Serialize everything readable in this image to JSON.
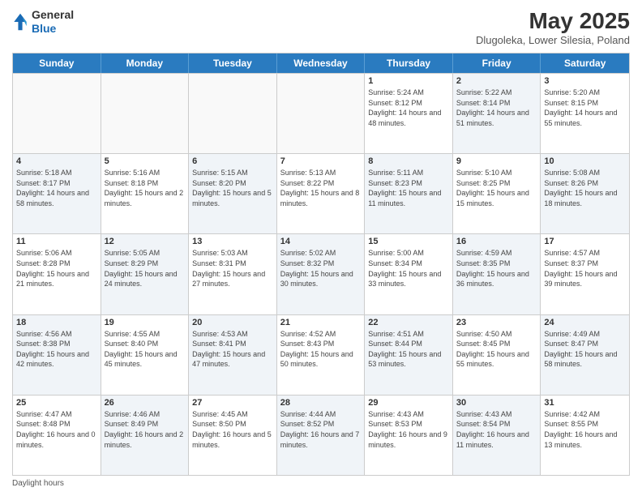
{
  "header": {
    "logo_line1": "General",
    "logo_line2": "Blue",
    "title": "May 2025",
    "subtitle": "Dlugoleka, Lower Silesia, Poland"
  },
  "days_of_week": [
    "Sunday",
    "Monday",
    "Tuesday",
    "Wednesday",
    "Thursday",
    "Friday",
    "Saturday"
  ],
  "weeks": [
    [
      {
        "day": "",
        "info": "",
        "shaded": false,
        "empty": true
      },
      {
        "day": "",
        "info": "",
        "shaded": false,
        "empty": true
      },
      {
        "day": "",
        "info": "",
        "shaded": false,
        "empty": true
      },
      {
        "day": "",
        "info": "",
        "shaded": false,
        "empty": true
      },
      {
        "day": "1",
        "info": "Sunrise: 5:24 AM\nSunset: 8:12 PM\nDaylight: 14 hours\nand 48 minutes.",
        "shaded": false,
        "empty": false
      },
      {
        "day": "2",
        "info": "Sunrise: 5:22 AM\nSunset: 8:14 PM\nDaylight: 14 hours\nand 51 minutes.",
        "shaded": true,
        "empty": false
      },
      {
        "day": "3",
        "info": "Sunrise: 5:20 AM\nSunset: 8:15 PM\nDaylight: 14 hours\nand 55 minutes.",
        "shaded": false,
        "empty": false
      }
    ],
    [
      {
        "day": "4",
        "info": "Sunrise: 5:18 AM\nSunset: 8:17 PM\nDaylight: 14 hours\nand 58 minutes.",
        "shaded": true,
        "empty": false
      },
      {
        "day": "5",
        "info": "Sunrise: 5:16 AM\nSunset: 8:18 PM\nDaylight: 15 hours\nand 2 minutes.",
        "shaded": false,
        "empty": false
      },
      {
        "day": "6",
        "info": "Sunrise: 5:15 AM\nSunset: 8:20 PM\nDaylight: 15 hours\nand 5 minutes.",
        "shaded": true,
        "empty": false
      },
      {
        "day": "7",
        "info": "Sunrise: 5:13 AM\nSunset: 8:22 PM\nDaylight: 15 hours\nand 8 minutes.",
        "shaded": false,
        "empty": false
      },
      {
        "day": "8",
        "info": "Sunrise: 5:11 AM\nSunset: 8:23 PM\nDaylight: 15 hours\nand 11 minutes.",
        "shaded": true,
        "empty": false
      },
      {
        "day": "9",
        "info": "Sunrise: 5:10 AM\nSunset: 8:25 PM\nDaylight: 15 hours\nand 15 minutes.",
        "shaded": false,
        "empty": false
      },
      {
        "day": "10",
        "info": "Sunrise: 5:08 AM\nSunset: 8:26 PM\nDaylight: 15 hours\nand 18 minutes.",
        "shaded": true,
        "empty": false
      }
    ],
    [
      {
        "day": "11",
        "info": "Sunrise: 5:06 AM\nSunset: 8:28 PM\nDaylight: 15 hours\nand 21 minutes.",
        "shaded": false,
        "empty": false
      },
      {
        "day": "12",
        "info": "Sunrise: 5:05 AM\nSunset: 8:29 PM\nDaylight: 15 hours\nand 24 minutes.",
        "shaded": true,
        "empty": false
      },
      {
        "day": "13",
        "info": "Sunrise: 5:03 AM\nSunset: 8:31 PM\nDaylight: 15 hours\nand 27 minutes.",
        "shaded": false,
        "empty": false
      },
      {
        "day": "14",
        "info": "Sunrise: 5:02 AM\nSunset: 8:32 PM\nDaylight: 15 hours\nand 30 minutes.",
        "shaded": true,
        "empty": false
      },
      {
        "day": "15",
        "info": "Sunrise: 5:00 AM\nSunset: 8:34 PM\nDaylight: 15 hours\nand 33 minutes.",
        "shaded": false,
        "empty": false
      },
      {
        "day": "16",
        "info": "Sunrise: 4:59 AM\nSunset: 8:35 PM\nDaylight: 15 hours\nand 36 minutes.",
        "shaded": true,
        "empty": false
      },
      {
        "day": "17",
        "info": "Sunrise: 4:57 AM\nSunset: 8:37 PM\nDaylight: 15 hours\nand 39 minutes.",
        "shaded": false,
        "empty": false
      }
    ],
    [
      {
        "day": "18",
        "info": "Sunrise: 4:56 AM\nSunset: 8:38 PM\nDaylight: 15 hours\nand 42 minutes.",
        "shaded": true,
        "empty": false
      },
      {
        "day": "19",
        "info": "Sunrise: 4:55 AM\nSunset: 8:40 PM\nDaylight: 15 hours\nand 45 minutes.",
        "shaded": false,
        "empty": false
      },
      {
        "day": "20",
        "info": "Sunrise: 4:53 AM\nSunset: 8:41 PM\nDaylight: 15 hours\nand 47 minutes.",
        "shaded": true,
        "empty": false
      },
      {
        "day": "21",
        "info": "Sunrise: 4:52 AM\nSunset: 8:43 PM\nDaylight: 15 hours\nand 50 minutes.",
        "shaded": false,
        "empty": false
      },
      {
        "day": "22",
        "info": "Sunrise: 4:51 AM\nSunset: 8:44 PM\nDaylight: 15 hours\nand 53 minutes.",
        "shaded": true,
        "empty": false
      },
      {
        "day": "23",
        "info": "Sunrise: 4:50 AM\nSunset: 8:45 PM\nDaylight: 15 hours\nand 55 minutes.",
        "shaded": false,
        "empty": false
      },
      {
        "day": "24",
        "info": "Sunrise: 4:49 AM\nSunset: 8:47 PM\nDaylight: 15 hours\nand 58 minutes.",
        "shaded": true,
        "empty": false
      }
    ],
    [
      {
        "day": "25",
        "info": "Sunrise: 4:47 AM\nSunset: 8:48 PM\nDaylight: 16 hours\nand 0 minutes.",
        "shaded": false,
        "empty": false
      },
      {
        "day": "26",
        "info": "Sunrise: 4:46 AM\nSunset: 8:49 PM\nDaylight: 16 hours\nand 2 minutes.",
        "shaded": true,
        "empty": false
      },
      {
        "day": "27",
        "info": "Sunrise: 4:45 AM\nSunset: 8:50 PM\nDaylight: 16 hours\nand 5 minutes.",
        "shaded": false,
        "empty": false
      },
      {
        "day": "28",
        "info": "Sunrise: 4:44 AM\nSunset: 8:52 PM\nDaylight: 16 hours\nand 7 minutes.",
        "shaded": true,
        "empty": false
      },
      {
        "day": "29",
        "info": "Sunrise: 4:43 AM\nSunset: 8:53 PM\nDaylight: 16 hours\nand 9 minutes.",
        "shaded": false,
        "empty": false
      },
      {
        "day": "30",
        "info": "Sunrise: 4:43 AM\nSunset: 8:54 PM\nDaylight: 16 hours\nand 11 minutes.",
        "shaded": true,
        "empty": false
      },
      {
        "day": "31",
        "info": "Sunrise: 4:42 AM\nSunset: 8:55 PM\nDaylight: 16 hours\nand 13 minutes.",
        "shaded": false,
        "empty": false
      }
    ]
  ],
  "footer": {
    "label": "Daylight hours"
  }
}
